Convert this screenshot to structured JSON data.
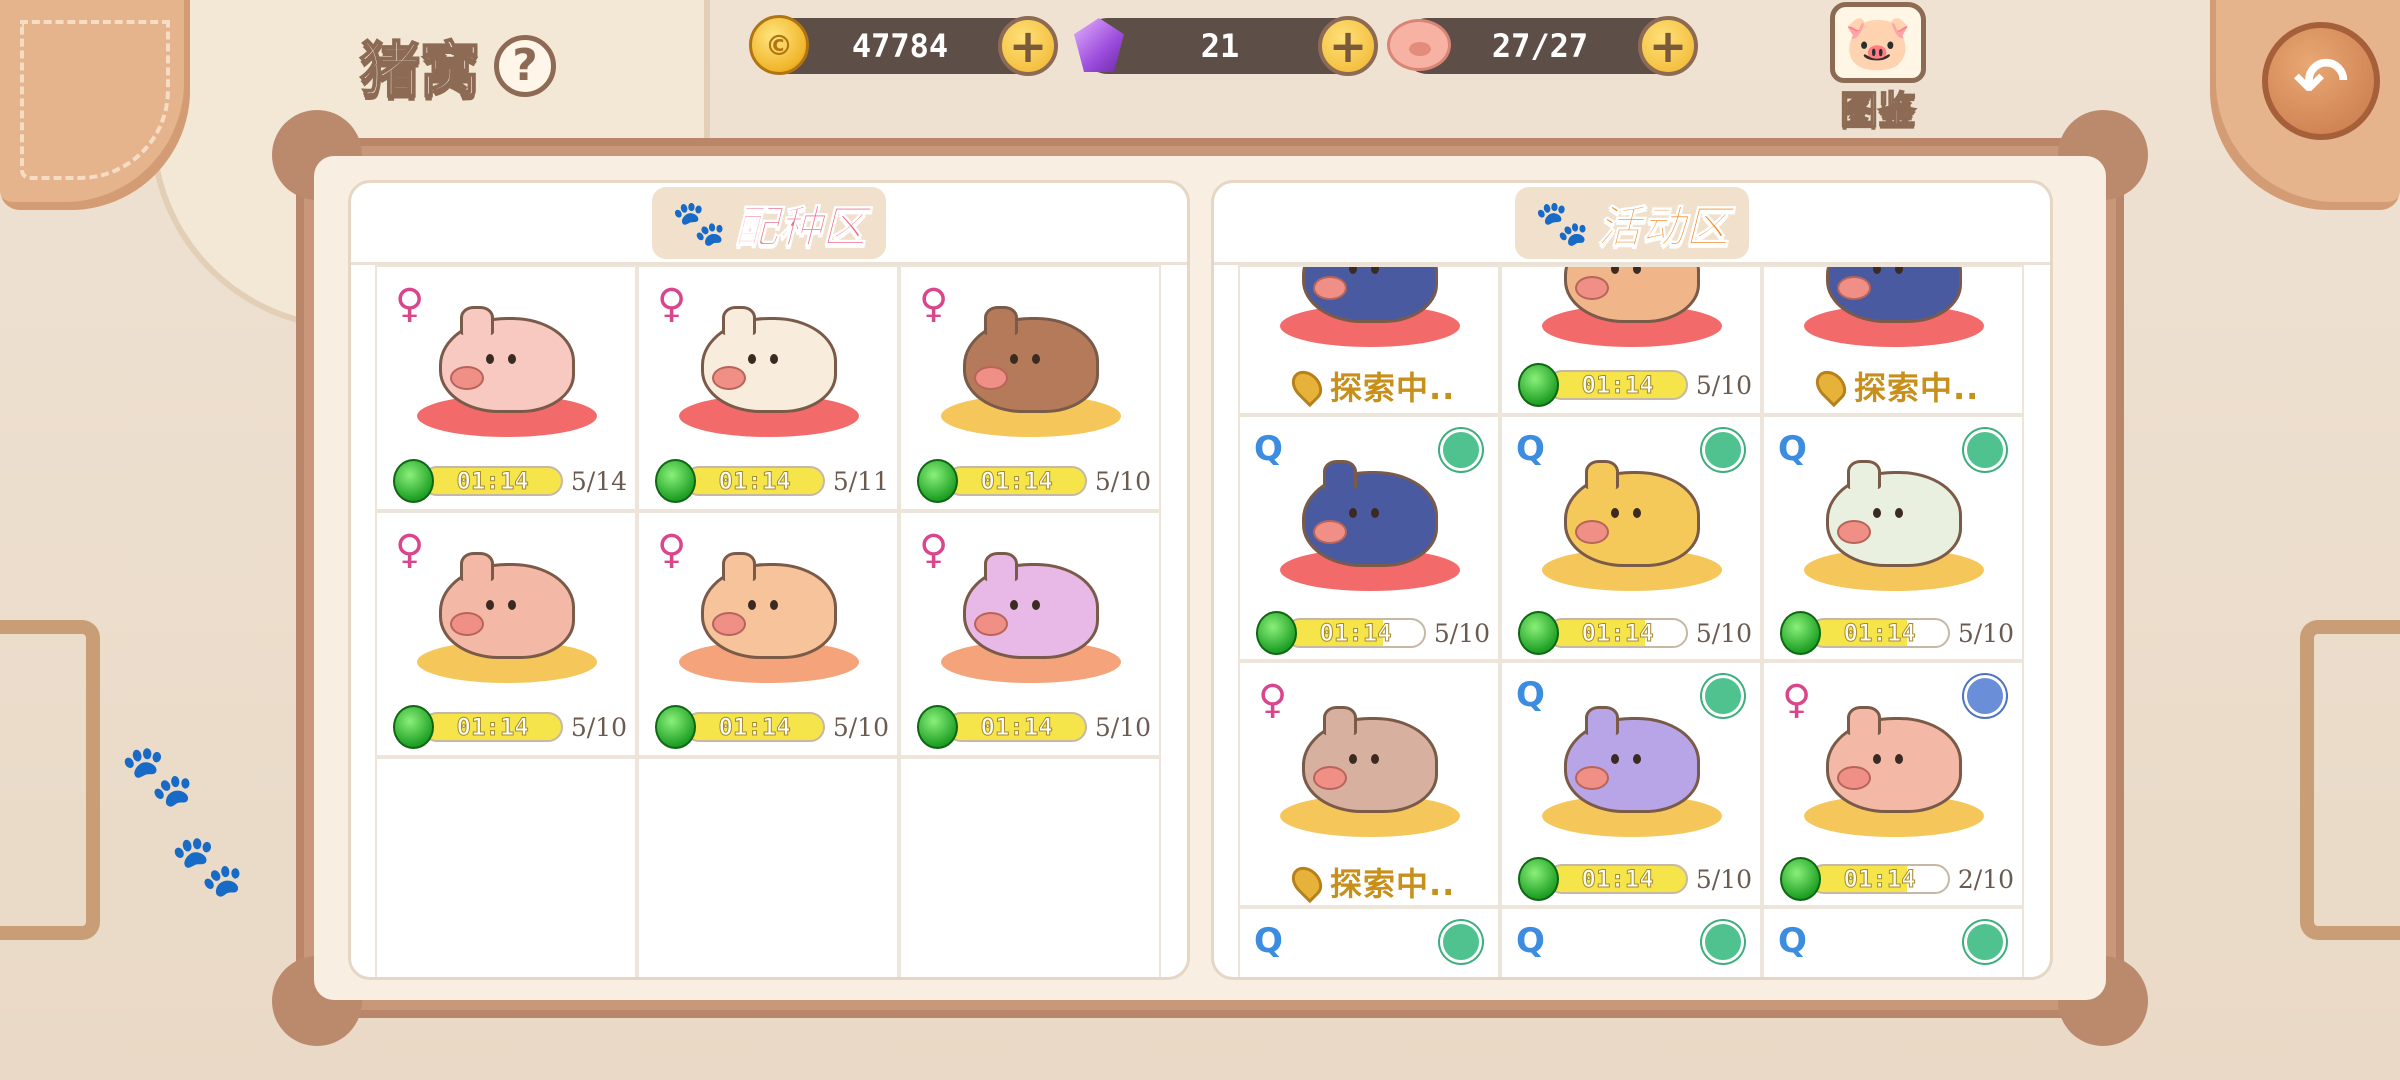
{
  "header": {
    "title": "猪窝",
    "help_icon": "question-icon",
    "gold": "47784",
    "gems": "21",
    "pigs": "27/27",
    "codex_label": "图鉴",
    "back_icon": "back-arrow-icon"
  },
  "breed_panel": {
    "title": "配种区",
    "cells": [
      {
        "gender": "♀",
        "timer": "01:14",
        "count": "5/14",
        "plate": "red",
        "color": "#f7c9c1"
      },
      {
        "gender": "♀",
        "timer": "01:14",
        "count": "5/11",
        "plate": "red",
        "color": "#f8eddc"
      },
      {
        "gender": "♀",
        "timer": "01:14",
        "count": "5/10",
        "plate": "yellow",
        "color": "#b57a5a"
      },
      {
        "gender": "♀",
        "timer": "01:14",
        "count": "5/10",
        "plate": "yellow",
        "color": "#f4b8a6"
      },
      {
        "gender": "♀",
        "timer": "01:14",
        "count": "5/10",
        "plate": "orange",
        "color": "#f7c39b"
      },
      {
        "gender": "♀",
        "timer": "01:14",
        "count": "5/10",
        "plate": "orange",
        "color": "#e8b8e6"
      }
    ]
  },
  "activity_panel": {
    "title": "活动区",
    "row1": [
      {
        "type": "explore",
        "text": "探索中.."
      },
      {
        "type": "timer",
        "timer": "01:14",
        "count": "5/10"
      },
      {
        "type": "explore",
        "text": "探索中.."
      }
    ],
    "row2": [
      {
        "badge": "Q",
        "timer": "01:14",
        "count": "5/10"
      },
      {
        "badge": "Q",
        "timer": "01:14",
        "count": "5/10"
      },
      {
        "badge": "Q",
        "timer": "01:14",
        "count": "5/10"
      }
    ],
    "row3": [
      {
        "badge": "♀",
        "type": "explore",
        "text": "探索中.."
      },
      {
        "badge": "Q",
        "type": "timer",
        "timer": "01:14",
        "count": "5/10"
      },
      {
        "badge": "♀",
        "type": "timer",
        "timer": "01:14",
        "count": "2/10"
      }
    ]
  },
  "colors": {
    "gem_green": "#22a227",
    "timer_yellow": "#f6e54a",
    "breed_title": "#f06b8a",
    "activity_title": "#f28c2a"
  }
}
